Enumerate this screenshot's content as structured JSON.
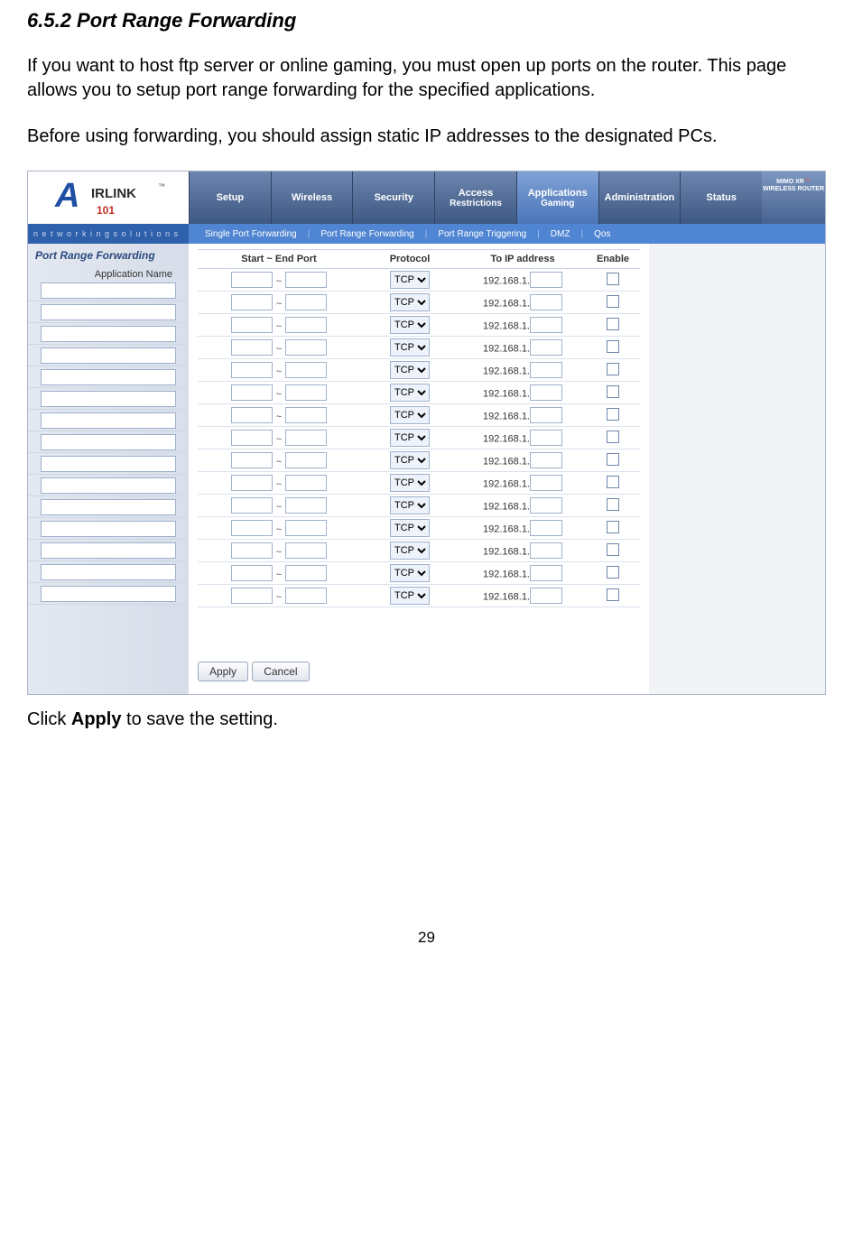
{
  "doc": {
    "heading": "6.5.2 Port Range Forwarding",
    "para1": "If you want to host ftp server or online gaming, you must open up ports on the router. This page allows you to setup port range forwarding for the specified applications.",
    "para2": "Before using forwarding, you should assign static IP addresses to the designated PCs.",
    "footer_pre": "Click ",
    "footer_bold": "Apply",
    "footer_post": " to save the setting.",
    "page_number": "29"
  },
  "logo": {
    "a": "A",
    "word": "IRLINK",
    "tm": "™",
    "sub": "101",
    "tag": "n e t w o r k i n g s o l u t i o n s"
  },
  "mimo": {
    "line1": "MIMO XR",
    "line2": "WIRELESS ROUTER"
  },
  "tabs": {
    "setup": "Setup",
    "wireless": "Wireless",
    "security": "Security",
    "access1": "Access",
    "access2": "Restrictions",
    "apps1": "Applications",
    "apps2": "Gaming",
    "admin": "Administration",
    "status": "Status"
  },
  "subtabs": {
    "a": "Single Port Forwarding",
    "b": "Port Range Forwarding",
    "c": "Port Range Triggering",
    "d": "DMZ",
    "e": "Qos"
  },
  "panel": {
    "title": "Port Range Forwarding",
    "app_label": "Application Name",
    "th_port": "Start ~ End Port",
    "th_proto": "Protocol",
    "th_ip": "To IP address",
    "th_enable": "Enable",
    "proto_opt": "TCP",
    "ip_prefix": "192.168.1.",
    "apply": "Apply",
    "cancel": "Cancel"
  },
  "row_count": 15
}
